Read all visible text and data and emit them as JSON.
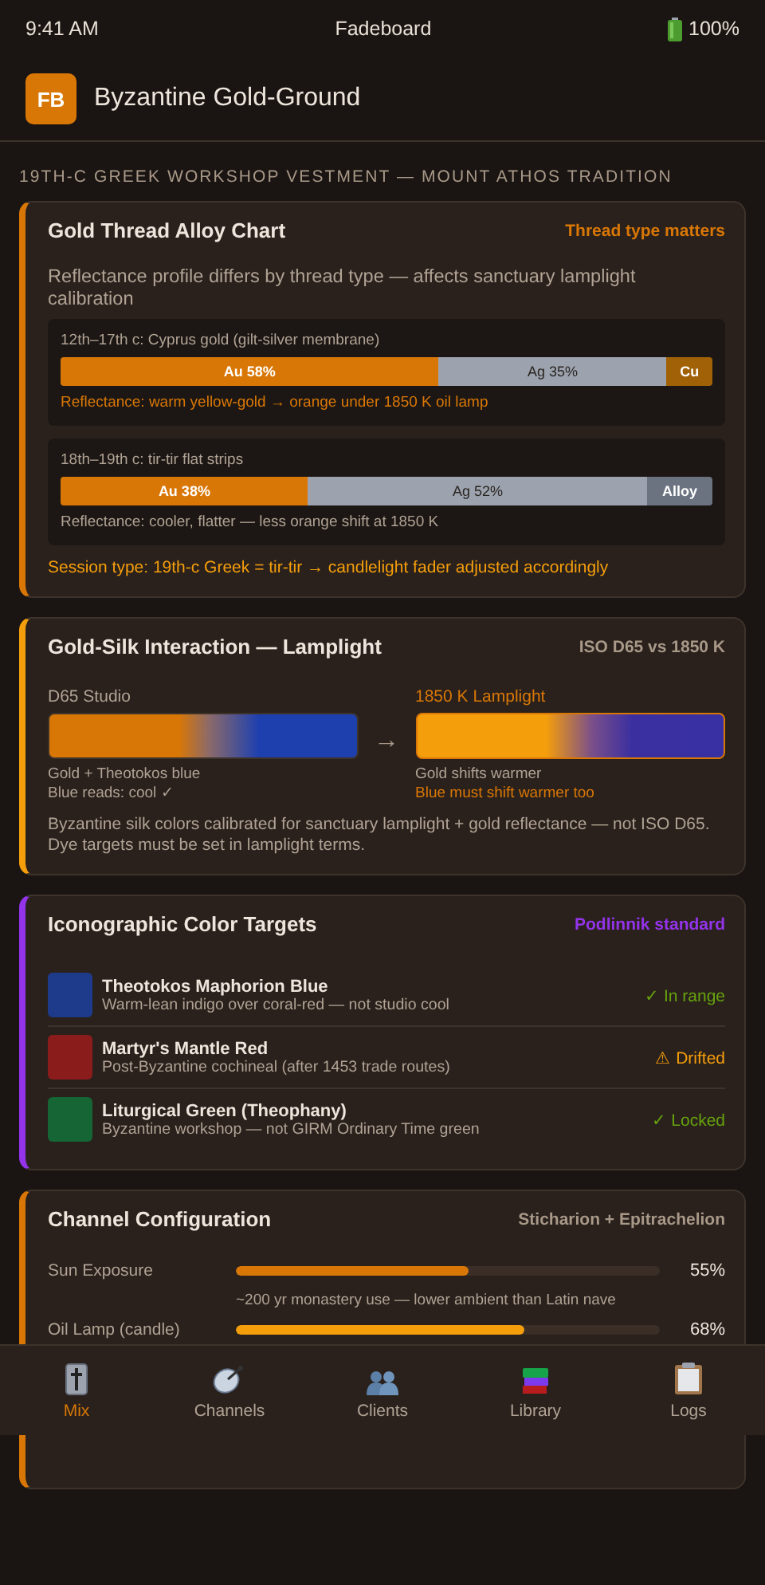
{
  "status_bar": {
    "time": "9:41 AM",
    "title": "Fadeboard",
    "battery": "100%"
  },
  "header": {
    "logo": "FB",
    "title": "Byzantine Gold-Ground"
  },
  "subtitle": "19TH-C GREEK WORKSHOP VESTMENT — MOUNT ATHOS TRADITION",
  "alloy_card": {
    "title": "Gold Thread Alloy Chart",
    "badge": "Thread type matters",
    "accent": true,
    "color": "#d97706",
    "description": "Reflectance profile differs by thread type — affects sanctuary lamplight calibration",
    "threads": [
      {
        "label": "12th–17th c: Cyprus gold (gilt-silver membrane)",
        "segments": [
          {
            "label": "Au 58%",
            "color": "#d97706"
          },
          {
            "label": "Ag 35%",
            "color": "#9ca3af"
          },
          {
            "label": "Cu",
            "color": "#a16207"
          }
        ],
        "note": "Reflectance: warm yellow-gold → orange under 1850 K oil lamp",
        "note_accent": true
      },
      {
        "label": "18th–19th c: tir-tir flat strips",
        "segments": [
          {
            "label": "Au 38%",
            "color": "#d97706"
          },
          {
            "label": "Ag 52%",
            "color": "#9ca3af"
          },
          {
            "label": "Alloy",
            "color": "#6b7280"
          }
        ],
        "note": "Reflectance: cooler, flatter — less orange shift at 1850 K",
        "note_accent": false
      }
    ],
    "footer": "Session type: 19th-c Greek = tir-tir → candlelight fader adjusted accordingly"
  },
  "interaction_card": {
    "title": "Gold-Silk Interaction — Lamplight",
    "badge": "ISO D65 vs 1850 K",
    "accent": false,
    "color": "#f59e0b",
    "panels": [
      {
        "kind": "studio",
        "label": "D65 Studio",
        "notes": [
          {
            "text": "Gold + Theotokos blue",
            "kind": "muted"
          },
          {
            "text": "Blue reads: cool ✓",
            "kind": "muted"
          }
        ]
      },
      {
        "kind": "lamplight",
        "label": "1850 K Lamplight",
        "notes": [
          {
            "text": "Gold shifts warmer",
            "kind": "muted"
          },
          {
            "text": "Blue must shift warmer too",
            "kind": "accent"
          }
        ]
      }
    ],
    "arrow": "→",
    "description": "Byzantine silk colors calibrated for sanctuary lamplight + gold reflectance — not ISO D65. Dye targets must be set in lamplight terms."
  },
  "targets_card": {
    "title": "Iconographic Color Targets",
    "badge": "Podlinnik standard",
    "accent": true,
    "color": "#9333ea",
    "targets": [
      {
        "name": "Theotokos Maphorion Blue",
        "description": "Warm-lean indigo over coral-red — not studio cool",
        "color": "#1e3a8a",
        "status": "✓ In range",
        "ok": true
      },
      {
        "name": "Martyr's Mantle Red",
        "description": "Post-Byzantine cochineal (after 1453 trade routes)",
        "color": "#8b1c1c",
        "status": "⚠ Drifted",
        "ok": false
      },
      {
        "name": "Liturgical Green (Theophany)",
        "description": "Byzantine workshop — not GIRM Ordinary Time green",
        "color": "#166534",
        "status": "✓ Locked",
        "ok": true
      }
    ]
  },
  "channels_card": {
    "title": "Channel Configuration",
    "badge": "Sticharion + Epitrachelion",
    "accent": false,
    "color": "#d97706",
    "channels": [
      {
        "name": "Sun Exposure",
        "level": 0.55,
        "reading": "55%",
        "color": "#d97706",
        "note": "~200 yr monastery use — lower ambient than Latin nave"
      },
      {
        "name": "Oil Lamp (candle)",
        "level": 0.68,
        "reading": "68%",
        "color": "#f59e0b"
      }
    ]
  },
  "tabs": [
    {
      "label": "Mix",
      "selected": true
    },
    {
      "label": "Channels",
      "selected": false
    },
    {
      "label": "Clients",
      "selected": false
    },
    {
      "label": "Library",
      "selected": false
    },
    {
      "label": "Logs",
      "selected": false
    }
  ]
}
